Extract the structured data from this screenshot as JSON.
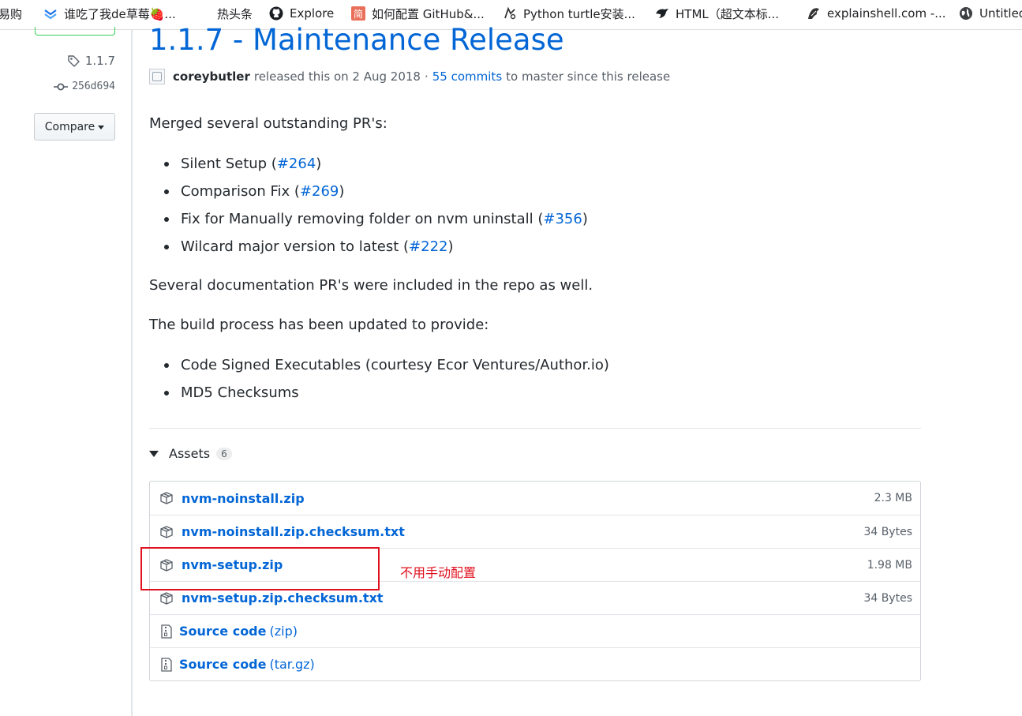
{
  "bookmarks": [
    {
      "label": "易购",
      "icon": "store-icon"
    },
    {
      "label": "谁吃了我de草莓🍓...",
      "icon": "bird-chevron-icon"
    },
    {
      "label": "热头条",
      "icon": "none"
    },
    {
      "label": "Explore",
      "icon": "github-icon"
    },
    {
      "label": "如何配置 GitHub&...",
      "icon": "jianshu-icon"
    },
    {
      "label": "Python turtle安装...",
      "icon": "turtle-icon"
    },
    {
      "label": "HTML（超文本标...",
      "icon": "bird-icon"
    },
    {
      "label": "explainshell.com -...",
      "icon": "shell-icon"
    },
    {
      "label": "Untitled",
      "icon": "globe-icon"
    }
  ],
  "sidebar": {
    "tag": "1.1.7",
    "commit": "256d694",
    "compare_label": "Compare"
  },
  "release": {
    "title": "1.1.7 - Maintenance Release",
    "author": "coreybutler",
    "released_text": "released this on 2 Aug 2018",
    "separator": "·",
    "commits_link": "55 commits",
    "commits_suffix": "to master since this release",
    "intro": "Merged several outstanding PR's:",
    "prs": [
      {
        "text": "Silent Setup (",
        "link": "#264",
        "close": ")"
      },
      {
        "text": "Comparison Fix (",
        "link": "#269",
        "close": ")"
      },
      {
        "text": "Fix for Manually removing folder on nvm uninstall (",
        "link": "#356",
        "close": ")"
      },
      {
        "text": "Wilcard major version to latest (",
        "link": "#222",
        "close": ")"
      }
    ],
    "docs_note": "Several documentation PR's were included in the repo as well.",
    "build_intro": "The build process has been updated to provide:",
    "build_items": [
      "Code Signed Executables (courtesy Ecor Ventures/Author.io)",
      "MD5 Checksums"
    ]
  },
  "assets": {
    "label": "Assets",
    "count": "6",
    "files": [
      {
        "name": "nvm-noinstall.zip",
        "size": "2.3 MB"
      },
      {
        "name": "nvm-noinstall.zip.checksum.txt",
        "size": "34 Bytes"
      },
      {
        "name": "nvm-setup.zip",
        "size": "1.98 MB"
      },
      {
        "name": "nvm-setup.zip.checksum.txt",
        "size": "34 Bytes"
      }
    ],
    "sources": [
      {
        "name": "Source code",
        "format": "(zip)"
      },
      {
        "name": "Source code",
        "format": "(tar.gz)"
      }
    ]
  },
  "annotation": {
    "note": "不用手动配置",
    "color": "#e0101e"
  },
  "colors": {
    "link": "#0366d6",
    "text": "#24292e",
    "muted": "#586069"
  }
}
